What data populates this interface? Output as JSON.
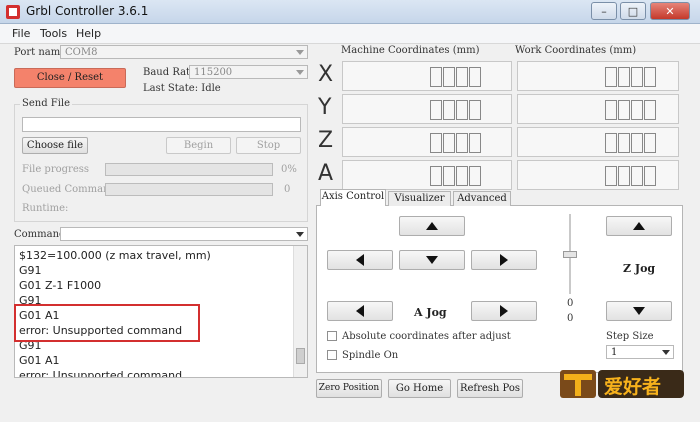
{
  "window": {
    "title": "Grbl Controller 3.6.1"
  },
  "menu": [
    "File",
    "Tools",
    "Help"
  ],
  "connection": {
    "port_label": "Port name",
    "port_value": "COM8",
    "close_button": "Close / Reset",
    "baud_label": "Baud Rate",
    "baud_value": "115200",
    "last_state": "Last State:  Idle"
  },
  "send_file": {
    "title": "Send File",
    "choose_button": "Choose file",
    "begin_button": "Begin",
    "stop_button": "Stop",
    "file_progress_label": "File progress",
    "file_progress_value": "0%",
    "queued_label": "Queued Commands",
    "queued_value": "0",
    "runtime_label": "Runtime:"
  },
  "command": {
    "label": "Command",
    "value": ""
  },
  "console_lines": [
    "$132=100.000 (z max travel, mm)",
    "G91",
    "G01 Z-1 F1000",
    "G91",
    "G01 A1",
    "error: Unsupported command",
    "G91",
    "G01 A1",
    "error: Unsupported command"
  ],
  "coordinates": {
    "machine_header": "Machine Coordinates      (mm)",
    "work_header": "Work Coordinates      (mm)",
    "axes": [
      "X",
      "Y",
      "Z",
      "A"
    ]
  },
  "tabs": [
    "Axis Control",
    "Visualizer",
    "Advanced"
  ],
  "axis_control": {
    "a_jog_label": "A Jog",
    "z_jog_label": "Z Jog",
    "slider_value_1": "0",
    "slider_value_2": "0",
    "abs_coords_label": "Absolute coordinates after adjust",
    "spindle_label": "Spindle On",
    "step_size_label": "Step Size",
    "step_size_value": "1"
  },
  "bottom_buttons": {
    "zero": "Zero Position",
    "home": "Go Home",
    "refresh": "Refresh Pos"
  },
  "highlight_color": "#d32f2f",
  "logo_text": "爱好者"
}
